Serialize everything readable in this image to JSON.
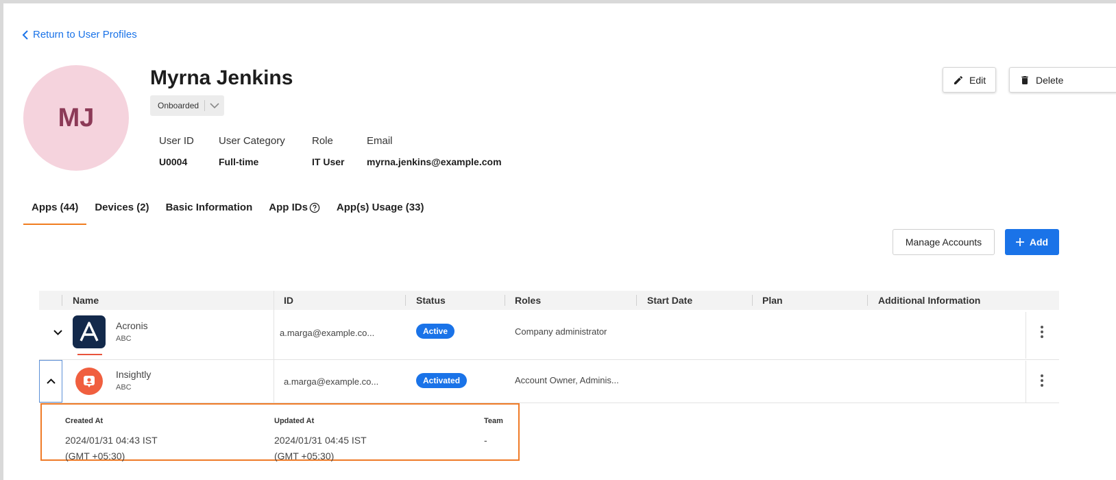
{
  "nav": {
    "back_label": "Return to User Profiles"
  },
  "profile": {
    "initials": "MJ",
    "name": "Myrna Jenkins",
    "status": "Onboarded",
    "fields": {
      "user_id": {
        "label": "User ID",
        "value": "U0004"
      },
      "category": {
        "label": "User Category",
        "value": "Full-time"
      },
      "role": {
        "label": "Role",
        "value": "IT User"
      },
      "email": {
        "label": "Email",
        "value": "myrna.jenkins@example.com"
      }
    }
  },
  "actions": {
    "edit_label": "Edit",
    "delete_label": "Delete"
  },
  "tabs": [
    {
      "label": "Apps (44)"
    },
    {
      "label": "Devices (2)"
    },
    {
      "label": "Basic Information"
    },
    {
      "label": "App IDs"
    },
    {
      "label": "App(s) Usage (33)"
    }
  ],
  "toolbar": {
    "manage_label": "Manage Accounts",
    "add_label": "Add"
  },
  "table": {
    "columns": [
      "Name",
      "ID",
      "Status",
      "Roles",
      "Start Date",
      "Plan",
      "Additional Information"
    ],
    "rows": [
      {
        "name": "Acronis",
        "org": "ABC",
        "id": "a.marga@example.co...",
        "status": "Active",
        "roles": "Company administrator"
      },
      {
        "name": "Insightly",
        "org": "ABC",
        "id": "a.marga@example.co...",
        "status": "Activated",
        "roles": "Account Owner, Adminis..."
      }
    ]
  },
  "details": {
    "created_label": "Created At",
    "created_line1": "2024/01/31 04:43 IST",
    "created_line2": "(GMT +05:30)",
    "updated_label": "Updated At",
    "updated_line1": "2024/01/31 04:45 IST",
    "updated_line2": "(GMT +05:30)",
    "team_label": "Team",
    "team_value": "-"
  },
  "colors": {
    "accent": "#1a73e8",
    "tab_underline": "#f07c1e",
    "avatar_bg": "#f5d3dd",
    "highlight_border": "#ef7a26"
  },
  "icons": [
    "chevron-left-icon",
    "chevron-down-icon",
    "pencil-icon",
    "trash-icon",
    "help-circle-icon",
    "plus-icon",
    "chevron-up-icon",
    "kebab-menu-icon",
    "acronis-logo",
    "insightly-logo"
  ]
}
